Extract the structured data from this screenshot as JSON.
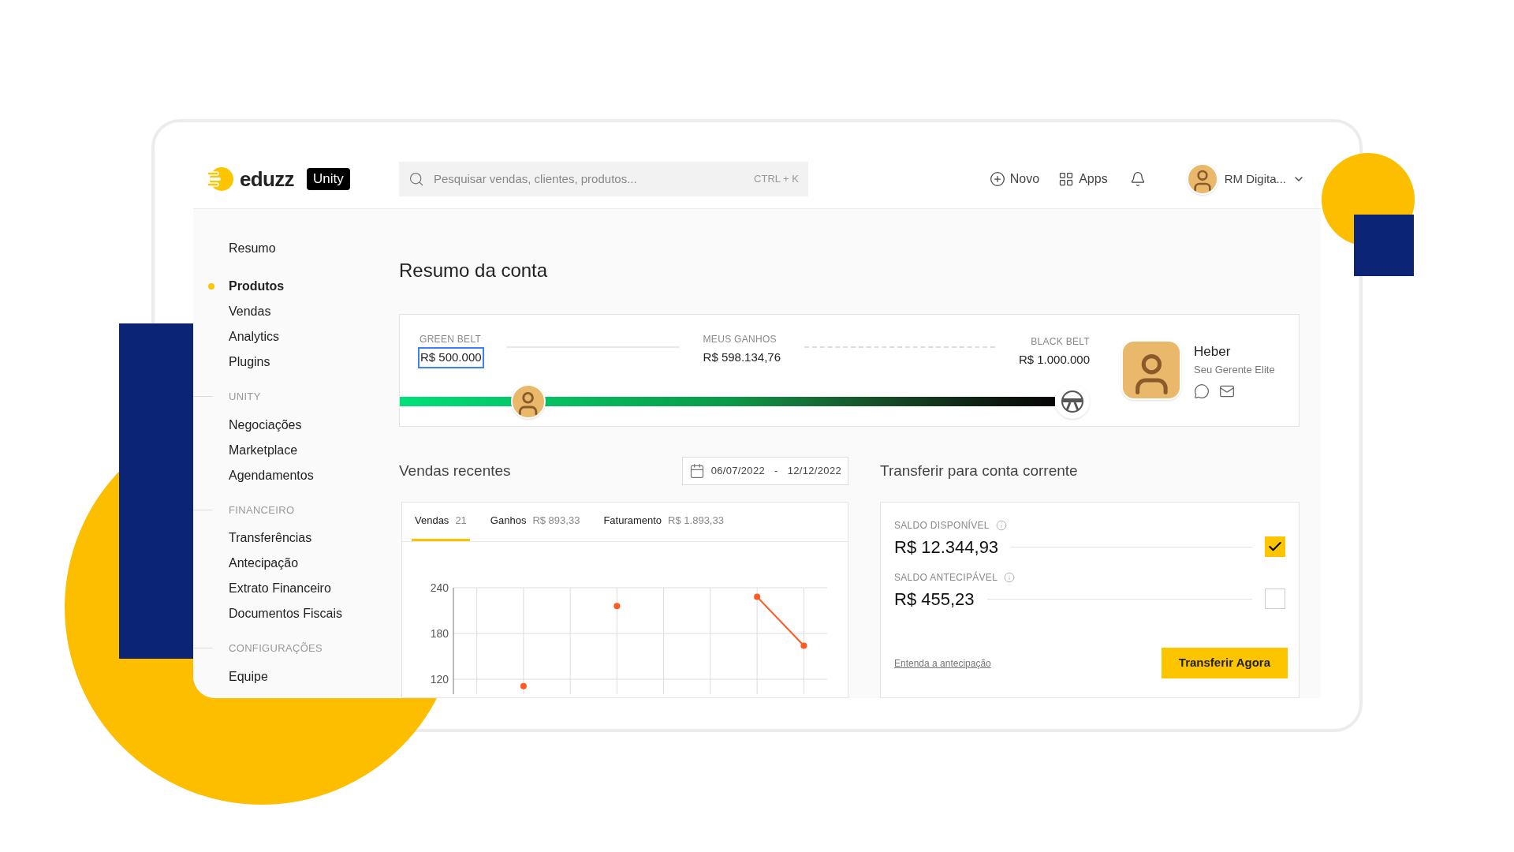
{
  "header": {
    "logo": "eduzz",
    "badge": "Unity",
    "search": {
      "placeholder": "Pesquisar vendas, clientes, produtos...",
      "shortcut": "CTRL + K"
    },
    "actions": [
      {
        "kind": "new",
        "label": "Novo"
      },
      {
        "kind": "apps",
        "label": "Apps"
      },
      {
        "kind": "notifications"
      }
    ],
    "user": {
      "name": "RM Digita..."
    }
  },
  "sidebar": {
    "sections": [
      {
        "items": [
          {
            "label": "Resumo",
            "selected": false
          }
        ]
      },
      {
        "items": [
          {
            "label": "Produtos",
            "selected": true
          },
          {
            "label": "Vendas",
            "selected": false
          },
          {
            "label": "Analytics",
            "selected": false
          },
          {
            "label": "Plugins",
            "selected": false
          }
        ]
      },
      {
        "title": "UNITY",
        "items": [
          {
            "label": "Negociações",
            "selected": false
          },
          {
            "label": "Marketplace",
            "selected": false
          },
          {
            "label": "Agendamentos",
            "selected": false
          }
        ]
      },
      {
        "title": "FINANCEIRO",
        "items": [
          {
            "label": "Transferências",
            "selected": false
          },
          {
            "label": "Antecipação",
            "selected": false
          },
          {
            "label": "Extrato Financeiro",
            "selected": false
          },
          {
            "label": "Documentos Fiscais",
            "selected": false
          }
        ]
      },
      {
        "title": "CONFIGURAÇÕES",
        "items": [
          {
            "label": "Equipe",
            "selected": false
          }
        ]
      }
    ]
  },
  "page_title": "Resumo da conta",
  "progress": {
    "start": {
      "label": "GREEN BELT",
      "value": "R$ 500.000",
      "focused": true
    },
    "current": {
      "label": "MEUS GANHOS",
      "value": "R$ 598.134,76"
    },
    "end": {
      "label": "BLACK BELT",
      "value": "R$ 1.000.000"
    }
  },
  "manager": {
    "name": "Heber",
    "role": "Seu Gerente Elite"
  },
  "sales": {
    "title": "Vendas recentes",
    "date_range": {
      "start": "06/07/2022",
      "separator": "-",
      "end": "12/12/2022"
    },
    "tabs": [
      {
        "label": "Vendas",
        "value": "21",
        "selected": true
      },
      {
        "label": "Ganhos",
        "value": "R$ 893,33",
        "selected": false
      },
      {
        "label": "Faturamento",
        "value": "R$ 1.893,33",
        "selected": false
      }
    ],
    "chart_data": {
      "type": "line",
      "grid": true,
      "categories": [
        null,
        null,
        null,
        null,
        null,
        null,
        null,
        null
      ],
      "ylim": [
        100,
        240
      ],
      "yticks": [
        120,
        180,
        240
      ],
      "series": [
        {
          "color": "#ff5a1f",
          "marker": "circle",
          "values": [
            null,
            111,
            null,
            216,
            null,
            null,
            228,
            164
          ]
        }
      ]
    }
  },
  "transfer": {
    "title": "Transferir para conta corrente",
    "balances": [
      {
        "label": "SALDO DISPONÍVEL",
        "amount": "R$ 12.344,93",
        "checked": true
      },
      {
        "label": "SALDO ANTECIPÁVEL",
        "amount": "R$ 455,23",
        "checked": false
      }
    ],
    "link": "Entenda a antecipação",
    "button": "Transferir Agora"
  }
}
